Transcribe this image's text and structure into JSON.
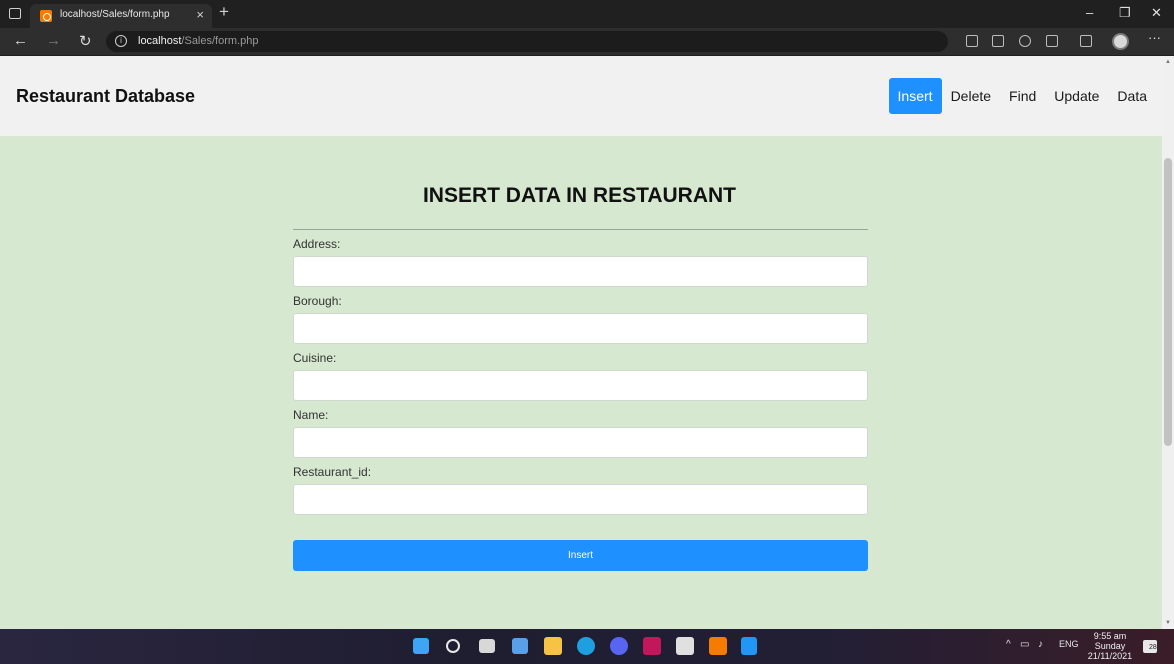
{
  "browser": {
    "tab_title": "localhost/Sales/form.php",
    "tab_close": "×",
    "new_tab": "+",
    "url_host": "localhost",
    "url_path": "/Sales/form.php",
    "back": "←",
    "forward": "→",
    "reload": "↻",
    "minimize": "–",
    "restore": "❐",
    "close": "✕",
    "more": "···"
  },
  "header": {
    "title": "Restaurant Database",
    "nav": [
      {
        "label": "Insert",
        "active": true
      },
      {
        "label": "Delete",
        "active": false
      },
      {
        "label": "Find",
        "active": false
      },
      {
        "label": "Update",
        "active": false
      },
      {
        "label": "Data",
        "active": false
      }
    ]
  },
  "form": {
    "title": "INSERT DATA IN RESTAURANT",
    "fields": [
      {
        "label": "Address:",
        "value": ""
      },
      {
        "label": "Borough:",
        "value": ""
      },
      {
        "label": "Cuisine:",
        "value": ""
      },
      {
        "label": "Name:",
        "value": ""
      },
      {
        "label": "Restaurant_id:",
        "value": ""
      }
    ],
    "submit_label": "Insert"
  },
  "taskbar": {
    "apps": [
      "windows-start-icon",
      "search-icon",
      "task-view-icon",
      "widgets-icon",
      "file-explorer-icon",
      "edge-icon",
      "discord-icon",
      "app-icon",
      "app-icon",
      "xampp-icon",
      "vscode-icon"
    ],
    "language": "ENG",
    "time": "9:55 am",
    "day": "Sunday",
    "date": "21/11/2021",
    "notification_count": "28"
  },
  "colors": {
    "accent": "#1e90ff",
    "page_background": "#d6e8d0",
    "header_background": "#f1f1f1"
  }
}
